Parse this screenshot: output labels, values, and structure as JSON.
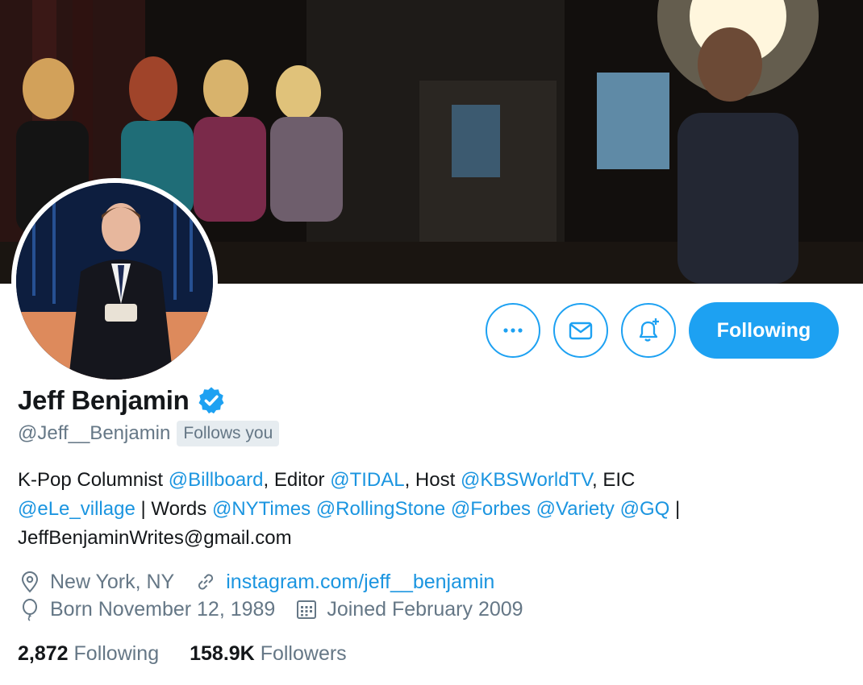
{
  "profile": {
    "name": "Jeff Benjamin",
    "handle": "@Jeff__Benjamin",
    "follows_you": "Follows you",
    "bio": {
      "line1": {
        "t1": "K-Pop Columnist ",
        "l1": "@Billboard",
        "t2": ", Editor ",
        "l2": "@TIDAL",
        "t3": ", Host ",
        "l3": "@KBSWorldTV",
        "t4": ", EIC"
      },
      "line2": {
        "l1": "@eLe_village",
        "t1": " | Words ",
        "l2": "@NYTimes",
        "l3": "@RollingStone",
        "l4": "@Forbes",
        "l5": "@Variety",
        "l6": "@GQ",
        "t2": " |"
      },
      "line3": "JeffBenjaminWrites@gmail.com"
    },
    "location": "New York, NY",
    "website": "instagram.com/jeff__benjamin",
    "birthday": "Born November 12, 1989",
    "joined": "Joined February 2009",
    "following_count": "2,872",
    "following_label": "Following",
    "followers_count": "158.9K",
    "followers_label": "Followers"
  },
  "actions": {
    "more_icon": "more-icon",
    "message_icon": "mail-icon",
    "notify_icon": "bell-plus-icon",
    "follow_label": "Following"
  },
  "colors": {
    "accent": "#1da1f2",
    "link": "#1b95e0",
    "muted": "#657786",
    "verified": "#1da1f2"
  }
}
